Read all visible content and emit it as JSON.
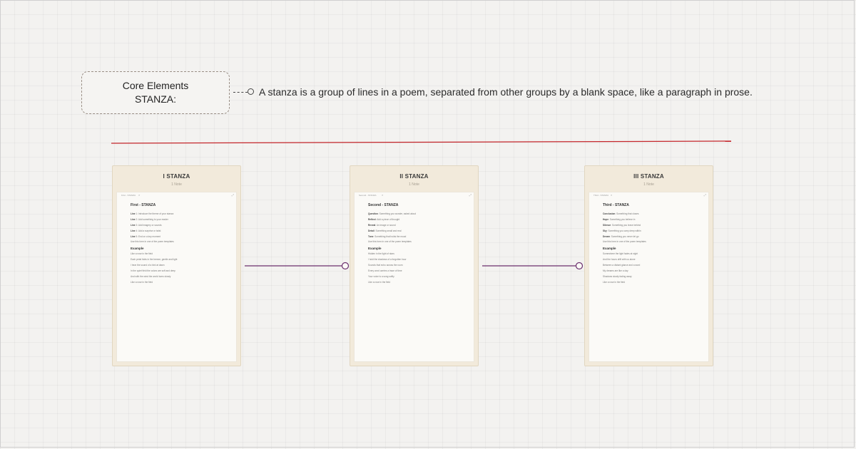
{
  "core": {
    "line1": "Core Elements",
    "line2": "STANZA:",
    "definition": "A stanza is a group of lines in a poem, separated from other groups by a blank space, like a paragraph in prose."
  },
  "colors": {
    "divider": "#c4262b",
    "link": "#6b2f6e",
    "card_bg": "#f2eadb"
  },
  "cards": [
    {
      "title": "I STANZA",
      "subtitle": "1 Note",
      "tab": "First - STANZA",
      "heading": "First - STANZA",
      "example_label": "Example",
      "lines_top": [
        {
          "b": "Line",
          "t": " 1: Introduce the theme of your stanza"
        },
        {
          "b": "Line",
          "t": " 2: Add something to your reader"
        },
        {
          "b": "Line",
          "t": " 3: Add imagery or sounds"
        },
        {
          "b": "Line",
          "t": " 4: Add a surprise or twist"
        },
        {
          "b": "Line",
          "t": " 5: End on a key moment"
        },
        {
          "b": "",
          "t": "Use this form in one of the poem templates"
        }
      ],
      "lines_bottom": [
        "Like a rose in the field",
        "Each petal folds in the breeze, gentle and light",
        "I hear the sound of a bird at dawn",
        "In the quiet field the colors are soft and deep",
        "And with the wind the world turns slowly",
        "Like a rose in the field"
      ]
    },
    {
      "title": "II STANZA",
      "subtitle": "1 Note",
      "tab": "Second - STANZA",
      "heading": "Second - STANZA",
      "example_label": "Example",
      "lines_top": [
        {
          "b": "Question",
          "t": ": Something you wonder, asked aloud"
        },
        {
          "b": "Reflect",
          "t": ": Add a piece of thought"
        },
        {
          "b": "Reveal",
          "t": ": An image or sound"
        },
        {
          "b": "Detail",
          "t": ": Something small and real"
        },
        {
          "b": "Tone",
          "t": ": Something that holds the mood"
        },
        {
          "b": "",
          "t": "Use this form in one of the poem templates"
        }
      ],
      "lines_bottom": [
        "Hidden in the light of stars",
        "I hold the shadows of a forgotten hour",
        "Sounds that echo across the room",
        "Every word carries a trace of time",
        "Your voice is a song softly",
        "Like a rose in the field"
      ]
    },
    {
      "title": "III STANZA",
      "subtitle": "1 Note",
      "tab": "Third - STANZA",
      "heading": "Third - STANZA",
      "example_label": "Example",
      "lines_top": [
        {
          "b": "Conclusion",
          "t": ": Something that closes"
        },
        {
          "b": "Hope",
          "t": ": Something you believe in"
        },
        {
          "b": "Silence",
          "t": ": Something you leave behind"
        },
        {
          "b": "Sky",
          "t": ": Something you carry deep within"
        },
        {
          "b": "Dream",
          "t": ": Something you never let go"
        },
        {
          "b": "",
          "t": "Use this form in one of the poem templates"
        }
      ],
      "lines_bottom": [
        "Somewhere the light fades at night",
        "And the hours drift with us alone",
        "Between a distant glance and a word",
        "My dreams are like a day",
        "Shadows slowly fading away",
        "Like a rose in the field"
      ]
    }
  ]
}
